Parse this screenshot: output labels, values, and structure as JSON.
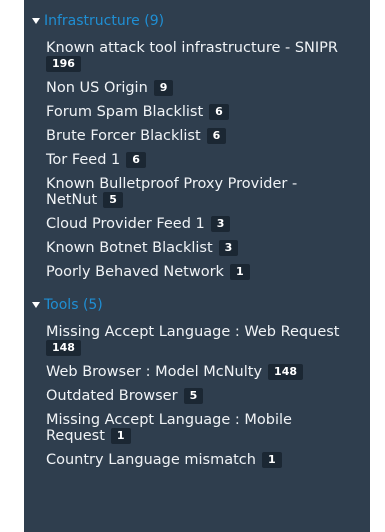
{
  "sections": [
    {
      "title": "Infrastructure (9)",
      "items": [
        {
          "label": "Known attack tool infrastructure - SNIPR",
          "count": "196"
        },
        {
          "label": "Non US Origin",
          "count": "9"
        },
        {
          "label": "Forum Spam Blacklist",
          "count": "6"
        },
        {
          "label": "Brute Forcer Blacklist",
          "count": "6"
        },
        {
          "label": "Tor Feed 1",
          "count": "6"
        },
        {
          "label": "Known Bulletproof Proxy Provider - NetNut",
          "count": "5"
        },
        {
          "label": "Cloud Provider Feed 1",
          "count": "3"
        },
        {
          "label": "Known Botnet Blacklist",
          "count": "3"
        },
        {
          "label": "Poorly Behaved Network",
          "count": "1"
        }
      ]
    },
    {
      "title": "Tools (5)",
      "items": [
        {
          "label": "Missing Accept Language : Web Request",
          "count": "148"
        },
        {
          "label": "Web Browser : Model McNulty",
          "count": "148"
        },
        {
          "label": "Outdated Browser",
          "count": "5"
        },
        {
          "label": "Missing Accept Language : Mobile Request",
          "count": "1"
        },
        {
          "label": "Country Language mismatch",
          "count": "1"
        }
      ]
    }
  ],
  "colors": {
    "panel_background": "#2f3e4e",
    "section_title": "#1f8fd4",
    "item_text": "#f0f3f6",
    "badge_background": "#1b2733"
  },
  "icons": {
    "section_toggle": "caret-down-icon"
  }
}
